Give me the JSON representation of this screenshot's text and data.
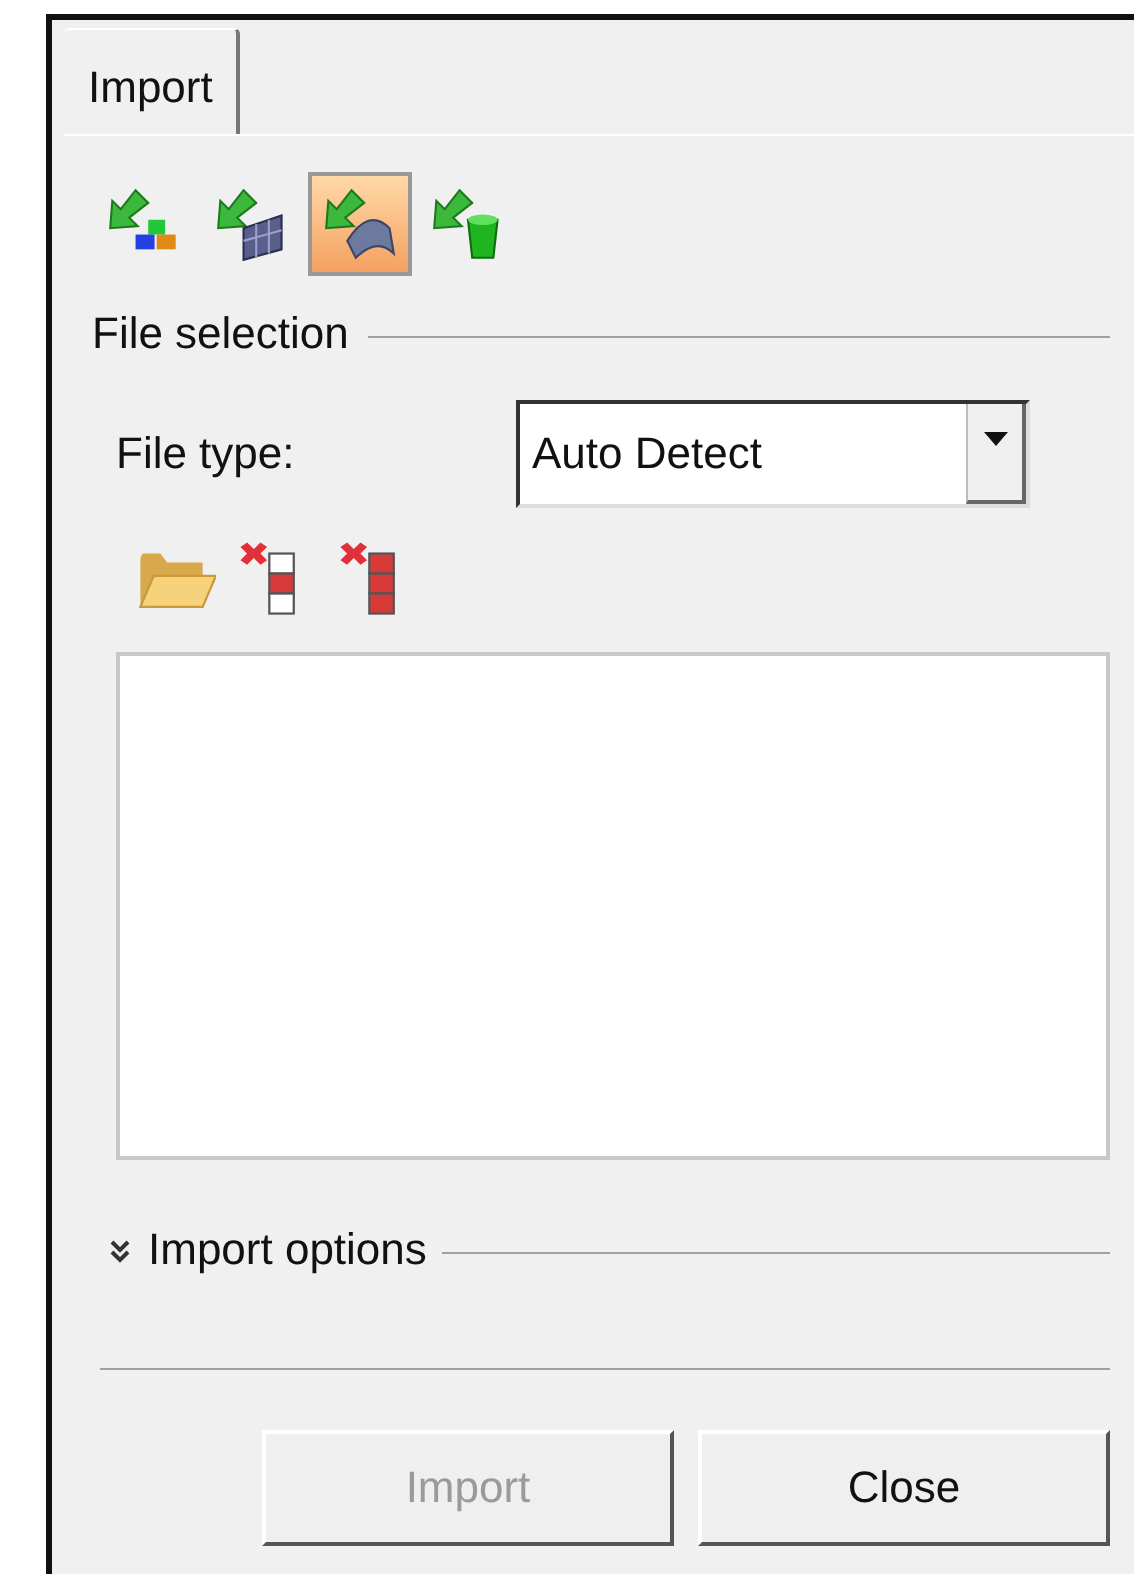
{
  "tabs": [
    {
      "label": "Import",
      "selected": true
    }
  ],
  "toolbar": [
    {
      "kind": "geometry",
      "selected": false
    },
    {
      "kind": "mesh",
      "selected": false
    },
    {
      "kind": "surface",
      "selected": true
    },
    {
      "kind": "solid",
      "selected": false
    }
  ],
  "file_selection": {
    "title": "File selection",
    "file_type_label": "File type:",
    "file_type": "Auto Detect",
    "tools": [
      {
        "kind": "open"
      },
      {
        "kind": "remove"
      },
      {
        "kind": "remove_all"
      }
    ]
  },
  "import_options": {
    "title": "Import options",
    "expanded": false
  },
  "buttons": [
    {
      "label": "Import",
      "disabled": true
    },
    {
      "label": "Close",
      "disabled": false
    }
  ]
}
